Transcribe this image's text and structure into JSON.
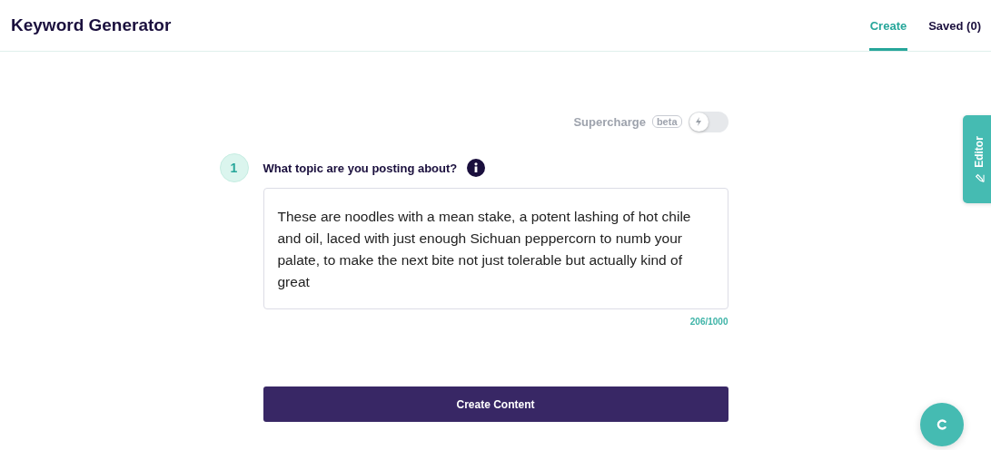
{
  "header": {
    "title": "Keyword Generator",
    "tabs": [
      {
        "label": "Create",
        "selected": true
      },
      {
        "label": "Saved (0)",
        "selected": false
      }
    ]
  },
  "supercharge": {
    "label": "Supercharge",
    "badge": "beta",
    "on": false
  },
  "step": {
    "number": "1",
    "question": "What topic are you posting about?",
    "value": "These are noodles with a mean stake, a potent lashing of hot chile and oil, laced with just enough Sichuan peppercorn to numb your palate, to make the next bite not just tolerable but actually kind of great",
    "counter": "206/1000"
  },
  "submit": {
    "label": "Create Content"
  },
  "editor_tab": {
    "label": "Editor"
  }
}
